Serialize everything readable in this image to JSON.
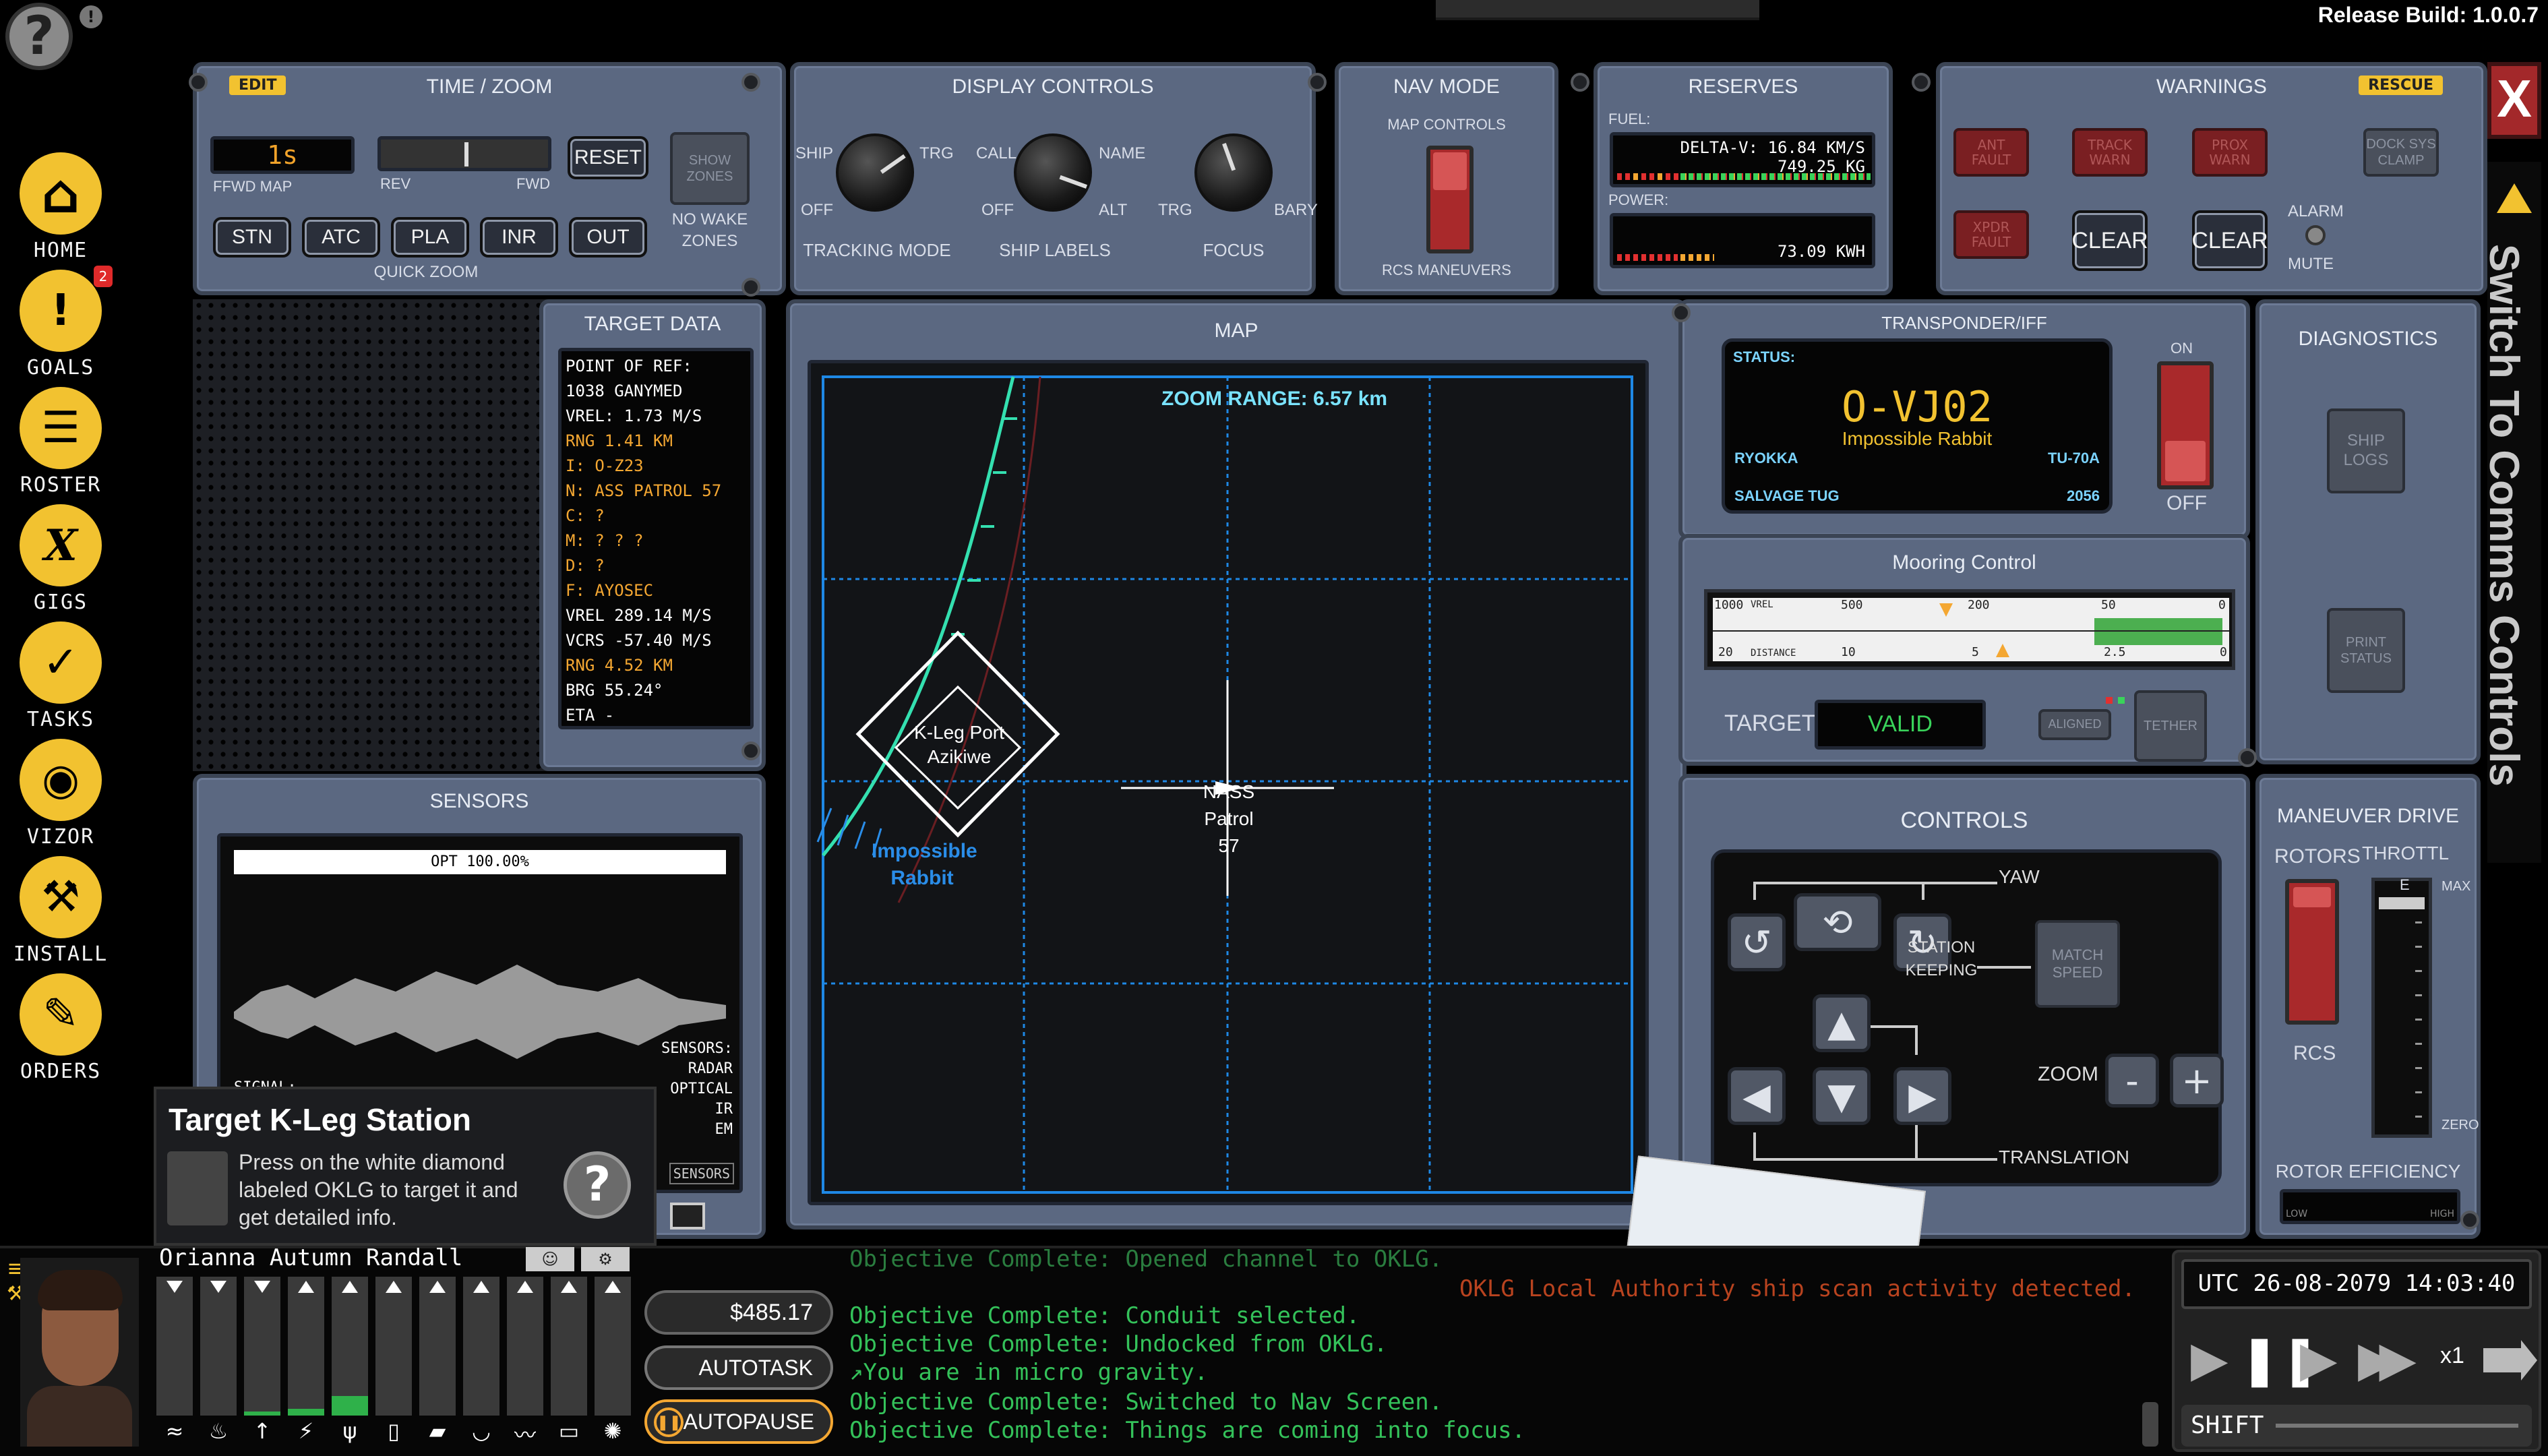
{
  "release_build": "Release Build: 1.0.0.7",
  "help": {
    "icon": "question-icon",
    "alert": "!"
  },
  "nav_rail": [
    {
      "label": "HOME",
      "icon": "home-icon",
      "glyph": "⌂"
    },
    {
      "label": "GOALS",
      "icon": "goals-icon",
      "glyph": "!",
      "badge": "2"
    },
    {
      "label": "ROSTER",
      "icon": "roster-icon",
      "glyph": "☰"
    },
    {
      "label": "GIGS",
      "icon": "gigs-icon",
      "glyph": "X"
    },
    {
      "label": "TASKS",
      "icon": "tasks-icon",
      "glyph": "✓"
    },
    {
      "label": "VIZOR",
      "icon": "eye-icon",
      "glyph": "◉"
    },
    {
      "label": "INSTALL",
      "icon": "hammer-icon",
      "glyph": "⚒"
    },
    {
      "label": "ORDERS",
      "icon": "orders-icon",
      "glyph": "✎"
    }
  ],
  "time_zoom": {
    "title": "TIME / ZOOM",
    "edit": "EDIT",
    "time_value": "1s",
    "ffwd_map": "FFWD MAP",
    "rev": "REV",
    "fwd": "FWD",
    "reset": "RESET",
    "show_zones": "SHOW ZONES",
    "no_wake_zones": "NO WAKE ZONES",
    "quick_zoom": "QUICK ZOOM",
    "zoom_buttons": [
      "STN",
      "ATC",
      "PLA",
      "INR",
      "OUT"
    ]
  },
  "display_controls": {
    "title": "DISPLAY CONTROLS",
    "tracking": {
      "left": "SHIP",
      "right": "TRG",
      "off": "OFF",
      "label": "TRACKING MODE"
    },
    "labels": {
      "left": "CALL",
      "right": "NAME",
      "off": "OFF",
      "alt": "ALT",
      "label": "SHIP LABELS"
    },
    "focus": {
      "left": "TRG",
      "right": "BARY",
      "label": "FOCUS"
    }
  },
  "nav_mode": {
    "title": "NAV MODE",
    "map_controls": "MAP CONTROLS",
    "rcs": "RCS MANEUVERS"
  },
  "reserves": {
    "title": "RESERVES",
    "fuel": "FUEL:",
    "delta_v": "DELTA-V: 16.84 KM/S",
    "mass": "749.25 KG",
    "power": "POWER:",
    "power_value": "73.09 KWH"
  },
  "warnings": {
    "title": "WARNINGS",
    "rescue": "RESCUE",
    "buttons": [
      "ANT FAULT",
      "TRACK WARN",
      "PROX WARN",
      "DOCK SYS CLAMP",
      "XPDR FAULT"
    ],
    "clear1": "CLEAR",
    "clear2": "CLEAR",
    "alarm": "ALARM",
    "mute": "MUTE",
    "close": "X"
  },
  "side_tab": "Switch To Comms Controls",
  "target_data": {
    "title": "TARGET DATA",
    "lines": [
      {
        "t": "POINT OF REF:",
        "o": false
      },
      {
        "t": "1038 GANYMED",
        "o": false
      },
      {
        "t": "VREL: 1.73 M/S",
        "o": false
      },
      {
        "t": "RNG 1.41 KM",
        "o": true
      },
      {
        "t": "I: O-Z23",
        "o": true
      },
      {
        "t": "N: ASS PATROL 57",
        "o": true
      },
      {
        "t": "C: ?",
        "o": true
      },
      {
        "t": "M: ? ? ?",
        "o": true
      },
      {
        "t": "D: ?",
        "o": true
      },
      {
        "t": "F: AYOSEC",
        "o": true
      },
      {
        "t": "VREL 289.14 M/S",
        "o": false
      },
      {
        "t": "VCRS -57.40 M/S",
        "o": false
      },
      {
        "t": "RNG 4.52 KM",
        "o": true
      },
      {
        "t": "BRG 55.24°",
        "o": false
      },
      {
        "t": "ETA -",
        "o": false
      }
    ]
  },
  "map": {
    "title": "MAP",
    "zoom_range": "ZOOM RANGE: 6.57 km",
    "station": "K-Leg Port Azikiwe",
    "ship": "Impossible Rabbit",
    "target": "NASS Patrol 57"
  },
  "sensors": {
    "title": "SENSORS",
    "opt": "OPT 100.00%",
    "signal": "SIGNAL:",
    "list": [
      "SENSORS:",
      "RADAR",
      "OPTICAL",
      "IR",
      "EM"
    ],
    "btn": "SENSORS"
  },
  "tooltip": {
    "title": "Target K-Leg Station",
    "body": "Press on the white diamond labeled OKLG to target it and get detailed info."
  },
  "transponder": {
    "title": "TRANSPONDER/IFF",
    "status": "STATUS:",
    "id": "O-VJ02",
    "name": "Impossible Rabbit",
    "owner": "RYOKKA",
    "model": "TU-70A",
    "class": "SALVAGE TUG",
    "year": "2056",
    "on": "ON",
    "off": "OFF"
  },
  "diagnostics": {
    "title": "DIAGNOSTICS",
    "ship_logs": "SHIP LOGS",
    "print_status": "PRINT STATUS"
  },
  "mooring": {
    "title": "Mooring Control",
    "vrel_ticks": [
      "1000",
      "500",
      "200",
      "50",
      "0"
    ],
    "vrel": "VREL",
    "dist_ticks": [
      "20",
      "10",
      "5",
      "2.5",
      "0"
    ],
    "distance": "DISTANCE",
    "target": "TARGET",
    "valid": "VALID",
    "aligned": "ALIGNED",
    "tether": "TETHER"
  },
  "controls": {
    "title": "CONTROLS",
    "yaw": "YAW",
    "station_keeping": "STATION KEEPING",
    "match_speed": "MATCH SPEED",
    "zoom": "ZOOM",
    "minus": "-",
    "plus": "+",
    "translation": "TRANSLATION"
  },
  "maneuver": {
    "title": "MANEUVER DRIVE",
    "rotors": "ROTORS",
    "throttle": "THROTTL",
    "e": "E",
    "max": "MAX",
    "zero": "ZERO",
    "rcs": "RCS",
    "rotor_eff": "ROTOR EFFICIENCY",
    "low": "LOW",
    "high": "HIGH"
  },
  "crew": {
    "name": "Orianna Autumn Randall",
    "money": "$485.17",
    "autotask": "AUTOTASK",
    "autopause": "AUTOPAUSE",
    "need_levels": [
      0.0,
      0.0,
      0.03,
      0.05,
      0.14,
      0.0,
      0.0,
      0.0,
      0.0,
      0.0,
      0.0,
      0.0
    ],
    "need_icons": [
      "waves-icon",
      "fire-icon",
      "temp-icon",
      "power-icon",
      "food-icon",
      "drink-icon",
      "bag-icon",
      "toilet-icon",
      "heart-icon",
      "bed-icon",
      "wash-icon"
    ]
  },
  "log": [
    "Objective Complete: Opened channel to OKLG.",
    "Objective Complete: Conduit selected.",
    "Objective Complete: Undocked from OKLG.",
    "↗You are in micro gravity.",
    "Objective Complete: Switched to Nav Screen.",
    "Objective Complete: Things are coming into focus."
  ],
  "log_alert": "OKLG Local Authority ship scan activity detected.",
  "clock": {
    "utc": "UTC 26-08-2079 14:03:40",
    "speed": "x1",
    "shift": "SHIFT"
  },
  "colors": {
    "panel": "#5b6881",
    "accent": "#f2c230",
    "green": "#34c25a",
    "orange": "#f4a732",
    "map_line": "#1e88e5"
  }
}
